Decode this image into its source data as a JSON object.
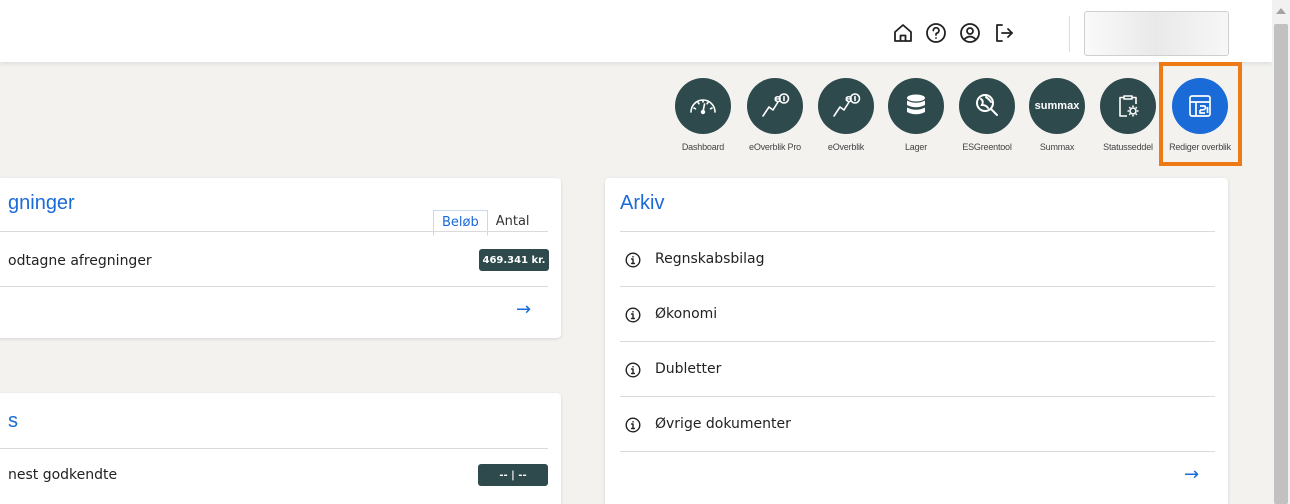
{
  "topbar": {
    "icons": [
      "home-icon",
      "help-icon",
      "user-icon",
      "logout-icon"
    ]
  },
  "apps": [
    {
      "label": "Dashboard",
      "icon": "gauge-icon"
    },
    {
      "label": "eOverblik Pro",
      "icon": "eoverblik-pro-icon"
    },
    {
      "label": "eOverblik",
      "icon": "eoverblik-icon"
    },
    {
      "label": "Lager",
      "icon": "database-icon"
    },
    {
      "label": "ESGreentool",
      "icon": "globe-search-icon"
    },
    {
      "label": "Summax",
      "icon": "summax-logo",
      "logo_text": "summax"
    },
    {
      "label": "Statusseddel",
      "icon": "clipboard-gear-icon"
    },
    {
      "label": "Rediger overblik",
      "icon": "layout-edit-icon"
    }
  ],
  "colors": {
    "accent": "#1a6ad8",
    "app_bg": "#2e4a4c",
    "highlight": "#ee7a15"
  },
  "afregninger": {
    "title": "gninger",
    "tabs": [
      "Beløb",
      "Antal"
    ],
    "active_tab": "Beløb",
    "row_label": "odtagne afregninger",
    "row_value": "469.341 kr.",
    "arrow": "→"
  },
  "godkendelser": {
    "title": "s",
    "row_label": "nest godkendte",
    "row_value": "-- | --"
  },
  "arkiv": {
    "title": "Arkiv",
    "items": [
      "Regnskabsbilag",
      "Økonomi",
      "Dubletter",
      "Øvrige dokumenter"
    ],
    "arrow": "→"
  }
}
